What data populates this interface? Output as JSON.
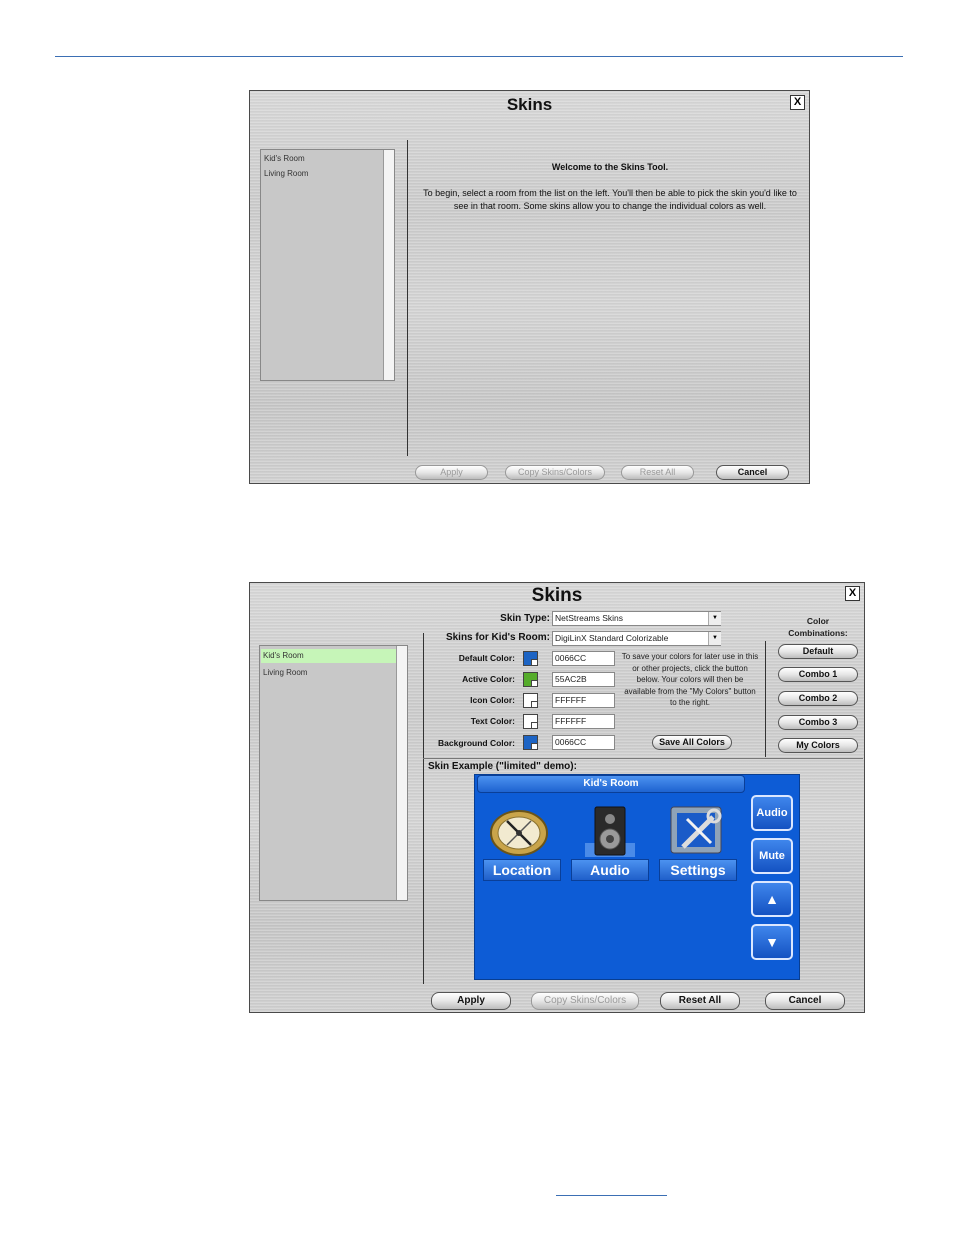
{
  "dialog1": {
    "title": "Skins",
    "close": "X",
    "rooms": [
      "Kid's Room",
      "Living Room"
    ],
    "welcome_title": "Welcome to the Skins Tool.",
    "welcome_body": "To begin, select a room from the list on the left.   You'll then be able to pick the skin you'd like to see in that room.   Some skins allow you to change the individual colors as well.",
    "buttons": {
      "apply": "Apply",
      "copy": "Copy Skins/Colors",
      "reset": "Reset All",
      "cancel": "Cancel"
    }
  },
  "dialog2": {
    "title": "Skins",
    "close": "X",
    "rooms": [
      "Kid's Room",
      "Living Room"
    ],
    "skin_type_label": "Skin Type:",
    "skin_type_value": "NetStreams Skins",
    "skins_for_label": "Skins for Kid's Room:",
    "skins_for_value": "DigiLinX Standard Colorizable",
    "colors": [
      {
        "label": "Default Color:",
        "value": "0066CC",
        "swatch": "#1d64c4"
      },
      {
        "label": "Active Color:",
        "value": "55AC2B",
        "swatch": "#55ac2b"
      },
      {
        "label": "Icon Color:",
        "value": "FFFFFF",
        "swatch": "#ffffff"
      },
      {
        "label": "Text Color:",
        "value": "FFFFFF",
        "swatch": "#ffffff"
      },
      {
        "label": "Background Color:",
        "value": "0066CC",
        "swatch": "#1d64c4"
      }
    ],
    "hint": "To save your colors for later use in this or other projects, click the button below.  Your colors will then be available from the \"My Colors\" button to the right.",
    "save_all_colors": "Save All Colors",
    "combos_title": "Color Combinations:",
    "combos": [
      "Default",
      "Combo 1",
      "Combo 2",
      "Combo 3",
      "My Colors"
    ],
    "example_label": "Skin Example (\"limited\" demo):",
    "preview": {
      "room": "Kid's Room",
      "tiles": [
        "Location",
        "Audio",
        "Settings"
      ],
      "side_buttons": [
        "Audio",
        "Mute"
      ]
    },
    "buttons": {
      "apply": "Apply",
      "copy": "Copy Skins/Colors",
      "reset": "Reset All",
      "cancel": "Cancel"
    }
  }
}
